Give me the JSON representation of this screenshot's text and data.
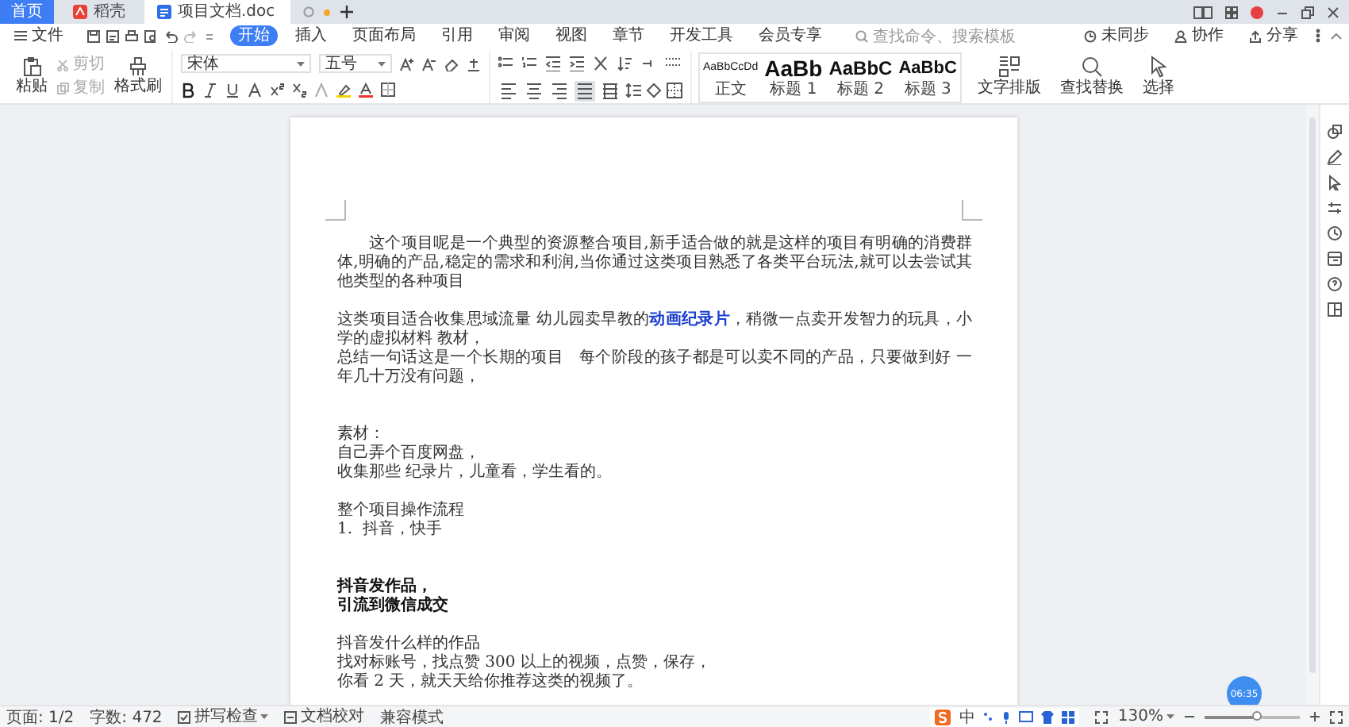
{
  "tabs": [
    {
      "label": "首页",
      "kind": "home",
      "selected": false
    },
    {
      "label": "稻壳",
      "kind": "docer",
      "selected": false
    },
    {
      "label": "项目文档.doc",
      "kind": "doc",
      "selected": true
    }
  ],
  "file_menu": "文件",
  "menu": [
    {
      "label": "开始",
      "selected": true
    },
    {
      "label": "插入",
      "selected": false
    },
    {
      "label": "页面布局",
      "selected": false
    },
    {
      "label": "引用",
      "selected": false
    },
    {
      "label": "审阅",
      "selected": false
    },
    {
      "label": "视图",
      "selected": false
    },
    {
      "label": "章节",
      "selected": false
    },
    {
      "label": "开发工具",
      "selected": false
    },
    {
      "label": "会员专享",
      "selected": false
    }
  ],
  "search": {
    "placeholder": "查找命令、搜索模板"
  },
  "top_right": [
    {
      "label": "未同步",
      "kind": "sync"
    },
    {
      "label": "协作",
      "kind": "people"
    },
    {
      "label": "分享",
      "kind": "share"
    }
  ],
  "ribbon": {
    "paste": "粘贴",
    "cut": {
      "label": "剪切",
      "disabled": true
    },
    "copy": {
      "label": "复制",
      "disabled": true
    },
    "format_painter": "格式刷",
    "font": "宋体",
    "size": "五号",
    "alignments": [
      {
        "kind": "left",
        "selected": false
      },
      {
        "kind": "center",
        "selected": false
      },
      {
        "kind": "right",
        "selected": false
      },
      {
        "kind": "justify",
        "selected": true
      },
      {
        "kind": "distributed",
        "selected": false
      }
    ],
    "styles": [
      {
        "sample": "AaBbCcDd",
        "label": "正文",
        "kind": "normal"
      },
      {
        "sample": "AaBb",
        "label": "标题 1",
        "kind": "h1"
      },
      {
        "sample": "AaBbC",
        "label": "标题 2",
        "kind": "h2"
      },
      {
        "sample": "AaBbC",
        "label": "标题 3",
        "kind": "h3"
      }
    ],
    "tools": [
      {
        "label": "文字排版",
        "kind": "layout"
      },
      {
        "label": "查找替换",
        "kind": "find"
      },
      {
        "label": "选择",
        "kind": "select"
      }
    ]
  },
  "document": {
    "blocks": [
      {
        "bold": false,
        "lines": [
          {
            "text": "这个项目呢是一个典型的资源整合项目,新手适合做的就是这样的项目有明确的消费群体,明确的产品,稳定的需求和利润,当你通过这类项目熟悉了各类平台玩法,就可以去尝试其他类型的各种项目",
            "indent": true
          }
        ]
      },
      {
        "bold": false,
        "lines": [
          {
            "text": "这类项目适合收集思域流量 幼儿园卖早教的**动画纪录片**，稍微一点卖开发智力的玩具，小学的虚拟材料 教材，",
            "indent": false
          },
          {
            "text": "总结一句话这是一个长期的项目   每个阶段的孩子都是可以卖不同的产品，只要做到好 一年几十万没有问题，",
            "indent": false
          }
        ]
      },
      {
        "bold": false,
        "lines": [
          {
            "text": "素材：",
            "indent": false
          },
          {
            "text": "自己弄个百度网盘，",
            "indent": false
          },
          {
            "text": "收集那些 纪录片，儿童看，学生看的。",
            "indent": false
          }
        ]
      },
      {
        "bold": false,
        "lines": [
          {
            "text": "整个项目操作流程",
            "indent": false
          },
          {
            "text": "1.  抖音，快手",
            "indent": false
          }
        ]
      },
      {
        "bold": true,
        "lines": [
          {
            "text": "抖音发作品，",
            "indent": false
          },
          {
            "text": "引流到微信成交",
            "indent": false
          }
        ]
      },
      {
        "bold": false,
        "lines": [
          {
            "text": "抖音发什么样的作品",
            "indent": false
          },
          {
            "text": "找对标账号，找点赞 300 以上的视频，点赞，保存，",
            "indent": false
          },
          {
            "text": "你看 2 天，就天天给你推荐这类的视频了。",
            "indent": false
          }
        ]
      }
    ]
  },
  "timer": "06:35",
  "status": {
    "items": [
      {
        "label": "页面: 1/2",
        "kind": "text"
      },
      {
        "label": "字数: 472",
        "kind": "text"
      },
      {
        "label": "拼写检查",
        "kind": "check"
      },
      {
        "label": "文档校对",
        "kind": "proof"
      },
      {
        "label": "兼容模式",
        "kind": "text"
      }
    ],
    "ime": "中",
    "zoom": "130%",
    "zoom_slider": {
      "level": 0.55
    }
  }
}
